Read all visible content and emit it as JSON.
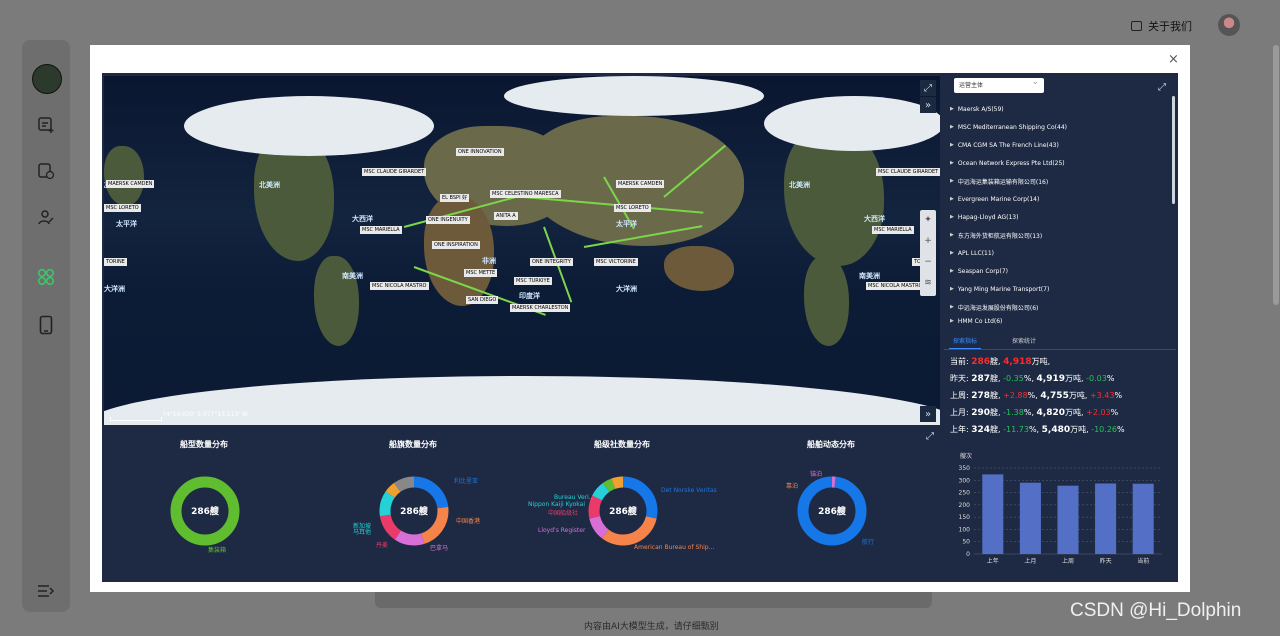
{
  "header": {
    "about_label": "关于我们"
  },
  "footer": {
    "disclaimer": "内容由AI大模型生成，请仔细甄别"
  },
  "watermark": "CSDN @Hi_Dolphin",
  "modal": {
    "close_glyph": "×"
  },
  "map": {
    "ocean_labels": [
      "北美洲",
      "北美洲",
      "北美洲",
      "太平洋",
      "大西洋",
      "太平洋",
      "大西洋",
      "南美洲",
      "南美洲",
      "大洋洲",
      "大洋洲",
      "印度洋",
      "非洲"
    ],
    "ship_labels": [
      "ONE INNOVATION",
      "MSC CLAUDE GIRARDET",
      "MSC CLAUDE GIRARDET",
      "MAERSK CAMDEN",
      "MAERSK CAMDEN",
      "MSC LORETO",
      "MSC LORETO",
      "MSC MARIELLA",
      "MSC MARIELLA",
      "ONE INGENUITY",
      "MSC CELESTINO MARESCA",
      "ANITA A",
      "EL BSPI 好",
      "ONE INSPIRATION",
      "MSC METTE",
      "MSC TURKIYE",
      "ONE INTEGRITY",
      "MSC VICTORINE",
      "MSC NICOLA MASTRO",
      "MSC NICOLA MASTRO",
      "SAN DIEGO",
      "MAERSK CHARLESTON",
      "TORINE",
      "TORINE"
    ],
    "coords": "74°59.020' S 077°13.113' W"
  },
  "charts": [
    {
      "title": "船型数量分布",
      "center": "286艘",
      "labels": [
        "集装箱"
      ]
    },
    {
      "title": "船旗数量分布",
      "center": "286艘",
      "labels": [
        "利比里亚",
        "中国香港",
        "巴拿马",
        "丹麦",
        "马耳他",
        "新加坡"
      ]
    },
    {
      "title": "船级社数量分布",
      "center": "286艘",
      "labels": [
        "Det Norske Veritas",
        "American Bureau of Ship...",
        "Lloyd's Register",
        "中国船级社",
        "Nippon Kaiji Kyokai",
        "Bureau Veri..."
      ]
    },
    {
      "title": "船舶动态分布",
      "center": "286艘",
      "labels": [
        "航行",
        "靠泊",
        "锚泊"
      ]
    }
  ],
  "operators": {
    "select_label": "运营主体",
    "items": [
      "Maersk A/S(59)",
      "MSC Mediterranean Shipping Co(44)",
      "CMA CGM SA The French Line(43)",
      "Ocean Network Express Pte Ltd(25)",
      "中远海运集装箱运输有限公司(16)",
      "Evergreen Marine Corp(14)",
      "Hapag-Lloyd AG(13)",
      "东方海外货柜航运有限公司(13)",
      "APL LLC(11)",
      "Seaspan Corp(7)",
      "Yang Ming Marine Transport(7)",
      "中远海运发展股份有限公司(6)",
      "HMM Co Ltd(6)"
    ]
  },
  "tabs": [
    "探索指标",
    "探索统计"
  ],
  "stats": {
    "current": {
      "label": "当前:",
      "ships": "286",
      "ships_unit": "艘,",
      "tonnage": "4,918",
      "tonnage_unit": "万吨,"
    },
    "rows": [
      {
        "label": "昨天:",
        "ships": "287",
        "ships_unit": "艘,",
        "ship_pct": "-0.35",
        "tonnage": "4,919",
        "tonnage_unit": "万吨,",
        "ton_pct": "-0.03",
        "ship_trend": "green",
        "ton_trend": "green"
      },
      {
        "label": "上周:",
        "ships": "278",
        "ships_unit": "艘,",
        "ship_pct": "+2.88",
        "tonnage": "4,755",
        "tonnage_unit": "万吨,",
        "ton_pct": "+3.43",
        "ship_trend": "red",
        "ton_trend": "red"
      },
      {
        "label": "上月:",
        "ships": "290",
        "ships_unit": "艘,",
        "ship_pct": "-1.38",
        "tonnage": "4,820",
        "tonnage_unit": "万吨,",
        "ton_pct": "+2.03",
        "ship_trend": "green",
        "ton_trend": "red"
      },
      {
        "label": "上年:",
        "ships": "324",
        "ships_unit": "艘,",
        "ship_pct": "-11.73",
        "tonnage": "5,480",
        "tonnage_unit": "万吨,",
        "ton_pct": "-10.26",
        "ship_trend": "green",
        "ton_trend": "green"
      }
    ],
    "pct_sign": "%,",
    "pct_end": "%"
  },
  "chart_data": {
    "type": "bar",
    "ylabel": "艘次",
    "categories": [
      "上年",
      "上月",
      "上周",
      "昨天",
      "当前"
    ],
    "values": [
      324,
      290,
      278,
      287,
      286
    ],
    "ylim": [
      0,
      350
    ],
    "yticks": [
      0,
      50,
      100,
      150,
      200,
      250,
      300,
      350
    ],
    "color": "#5470c6"
  }
}
